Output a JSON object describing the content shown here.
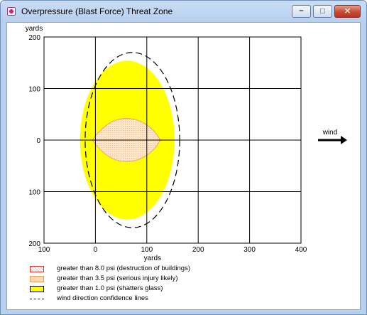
{
  "window": {
    "title": "Overpressure (Blast Force) Threat Zone",
    "buttons": {
      "minimize": "−",
      "maximize": "□",
      "close": "✕"
    }
  },
  "chart_data": {
    "type": "area",
    "title": "",
    "xlabel": "yards",
    "ylabel": "yards",
    "xlim": [
      -100,
      400
    ],
    "ylim": [
      -200,
      200
    ],
    "xticks": [
      -100,
      0,
      100,
      200,
      300,
      400
    ],
    "xtick_labels": [
      "100",
      "0",
      "100",
      "200",
      "300",
      "400"
    ],
    "yticks": [
      200,
      100,
      0,
      -100,
      -200
    ],
    "ytick_labels": [
      "200",
      "100",
      "0",
      "100",
      "200"
    ],
    "grid": true,
    "series": [
      {
        "name": "greater than 1.0 psi (shatters glass)",
        "shape": "ellipse",
        "center": [
          62,
          0
        ],
        "rx": 92,
        "ry": 154,
        "color": "#ffff00"
      },
      {
        "name": "greater than 3.5 psi (serious injury likely)",
        "shape": "blob",
        "center": [
          60,
          0
        ],
        "x_extent": [
          -6,
          126
        ],
        "y_extent": [
          -42,
          42
        ],
        "color": "#ffe6c8"
      },
      {
        "name": "wind direction confidence lines",
        "shape": "dashed-ellipse",
        "center": [
          72,
          0
        ],
        "rx": 92,
        "ry": 170,
        "color": "#000000"
      }
    ],
    "wind": {
      "label": "wind",
      "direction": "east"
    }
  },
  "legend": [
    {
      "label": "greater than 8.0 psi (destruction of buildings)",
      "fill": "#ffffff",
      "border": "#e03030"
    },
    {
      "label": "greater than 3.5 psi (serious injury likely)",
      "fill": "#ffd9b0",
      "border": "#e8a060"
    },
    {
      "label": "greater than 1.0 psi (shatters glass)",
      "fill": "#ffff00",
      "border": "#000000"
    },
    {
      "label": "wind direction confidence lines",
      "fill": "none",
      "border": "dashed"
    }
  ]
}
